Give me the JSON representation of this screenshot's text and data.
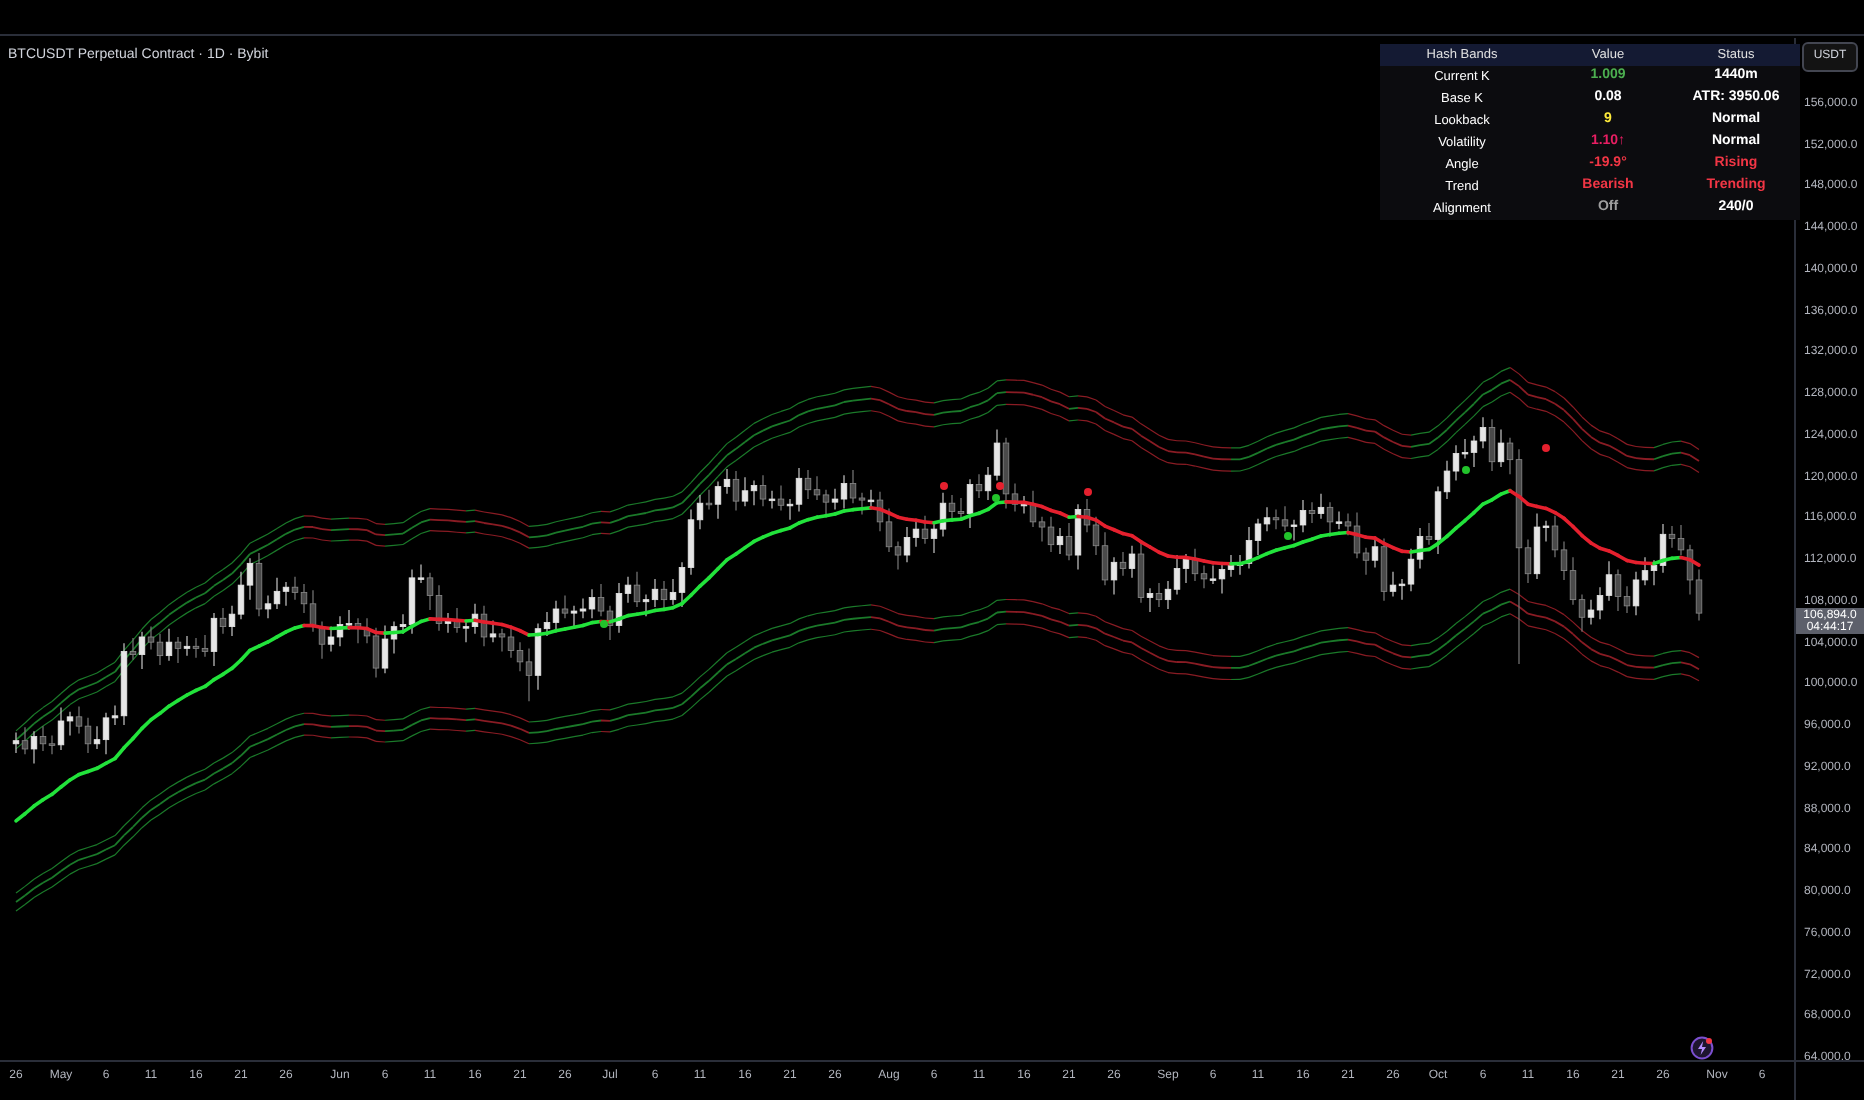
{
  "title": "BTCUSDT Perpetual Contract · 1D · Bybit",
  "currency_button": "USDT",
  "table": {
    "columns": [
      "Hash Bands",
      "Value",
      "Status"
    ],
    "rows": [
      {
        "label": "Current K",
        "value": {
          "text": "1.009",
          "color": "#4caf50"
        },
        "status": {
          "text": "1440m",
          "color": "#ffffff"
        }
      },
      {
        "label": "Base K",
        "value": {
          "text": "0.08",
          "color": "#ffffff"
        },
        "status": {
          "text": "ATR: 3950.06",
          "color": "#ffffff"
        }
      },
      {
        "label": "Lookback",
        "value": {
          "text": "9",
          "color": "#ffeb3b"
        },
        "status": {
          "text": "Normal",
          "color": "#ffffff"
        }
      },
      {
        "label": "Volatility",
        "value": {
          "text": "1.10↑",
          "color": "#e91e63"
        },
        "status": {
          "text": "Normal",
          "color": "#ffffff"
        }
      },
      {
        "label": "Angle",
        "value": {
          "text": "-19.9°",
          "color": "#f23645"
        },
        "status": {
          "text": "Rising",
          "color": "#f23645"
        }
      },
      {
        "label": "Trend",
        "value": {
          "text": "Bearish",
          "color": "#f23645"
        },
        "status": {
          "text": "Trending",
          "color": "#f23645"
        }
      },
      {
        "label": "Alignment",
        "value": {
          "text": "Off",
          "color": "#9e9e9e"
        },
        "status": {
          "text": "240/0",
          "color": "#ffffff"
        }
      }
    ]
  },
  "chart_data": {
    "type": "candlestick",
    "yticks": [
      {
        "value": 156000,
        "label": "156,000.0"
      },
      {
        "value": 152000,
        "label": "152,000.0"
      },
      {
        "value": 148000,
        "label": "148,000.0"
      },
      {
        "value": 144000,
        "label": "144,000.0"
      },
      {
        "value": 140000,
        "label": "140,000.0"
      },
      {
        "value": 136000,
        "label": "136,000.0"
      },
      {
        "value": 132000,
        "label": "132,000.0"
      },
      {
        "value": 128000,
        "label": "128,000.0"
      },
      {
        "value": 124000,
        "label": "124,000.0"
      },
      {
        "value": 120000,
        "label": "120,000.0"
      },
      {
        "value": 116000,
        "label": "116,000.0"
      },
      {
        "value": 112000,
        "label": "112,000.0"
      },
      {
        "value": 108000,
        "label": "108,000.0"
      },
      {
        "value": 104000,
        "label": "104,000.0"
      },
      {
        "value": 100000,
        "label": "100,000.0"
      },
      {
        "value": 96000,
        "label": "96,000.0"
      },
      {
        "value": 92000,
        "label": "92,000.0"
      },
      {
        "value": 88000,
        "label": "88,000.0"
      },
      {
        "value": 84000,
        "label": "84,000.0"
      },
      {
        "value": 80000,
        "label": "80,000.0"
      },
      {
        "value": 76000,
        "label": "76,000.0"
      },
      {
        "value": 72000,
        "label": "72,000.0"
      },
      {
        "value": 68000,
        "label": "68,000.0"
      },
      {
        "value": 64000,
        "label": "64,000.0"
      }
    ],
    "ylim": [
      59950,
      162360
    ],
    "categories": [
      "26",
      null,
      null,
      null,
      null,
      "May",
      null,
      null,
      null,
      null,
      "6",
      null,
      null,
      null,
      null,
      "11",
      null,
      null,
      null,
      null,
      "16",
      null,
      null,
      null,
      null,
      "21",
      null,
      null,
      null,
      null,
      "26",
      null,
      null,
      null,
      null,
      null,
      "Jun",
      null,
      null,
      null,
      null,
      "6",
      null,
      null,
      null,
      null,
      "11",
      null,
      null,
      null,
      null,
      "16",
      null,
      null,
      null,
      null,
      "21",
      null,
      null,
      null,
      null,
      "26",
      null,
      null,
      null,
      null,
      "Jul",
      null,
      null,
      null,
      null,
      "6",
      null,
      null,
      null,
      null,
      "11",
      null,
      null,
      null,
      null,
      "16",
      null,
      null,
      null,
      null,
      "21",
      null,
      null,
      null,
      null,
      "26",
      null,
      null,
      null,
      null,
      null,
      "Aug",
      null,
      null,
      null,
      null,
      "6",
      null,
      null,
      null,
      null,
      "11",
      null,
      null,
      null,
      null,
      "16",
      null,
      null,
      null,
      null,
      "21",
      null,
      null,
      null,
      null,
      "26",
      null,
      null,
      null,
      null,
      null,
      "Sep",
      null,
      null,
      null,
      null,
      "6",
      null,
      null,
      null,
      null,
      "11",
      null,
      null,
      null,
      null,
      "16",
      null,
      null,
      null,
      null,
      "21",
      null,
      null,
      null,
      null,
      "26",
      null,
      null,
      null,
      null,
      "Oct",
      null,
      null,
      null,
      null,
      "6",
      null,
      null,
      null,
      null,
      "11",
      null,
      null,
      null,
      null,
      "16",
      null,
      null,
      null,
      null,
      "21",
      null,
      null,
      null,
      null,
      "26",
      null,
      null,
      null,
      null,
      null,
      "Nov",
      null,
      null,
      null,
      null,
      "6"
    ],
    "ohlc": [
      [
        94300,
        95400,
        93400,
        94600
      ],
      [
        94600,
        95900,
        93300,
        93800
      ],
      [
        93800,
        95500,
        92400,
        95000
      ],
      [
        95000,
        96000,
        93600,
        94300
      ],
      [
        94300,
        95100,
        93300,
        94200
      ],
      [
        94200,
        97800,
        93700,
        96500
      ],
      [
        96500,
        97400,
        95100,
        96900
      ],
      [
        96900,
        97900,
        95300,
        96000
      ],
      [
        96000,
        96800,
        93400,
        94300
      ],
      [
        94300,
        96000,
        93800,
        94700
      ],
      [
        94700,
        97300,
        93300,
        96800
      ],
      [
        96800,
        98000,
        96100,
        97000
      ],
      [
        97000,
        104000,
        96100,
        103200
      ],
      [
        103200,
        104500,
        102400,
        102900
      ],
      [
        102900,
        105100,
        101500,
        104600
      ],
      [
        104600,
        105600,
        103400,
        104100
      ],
      [
        104100,
        104900,
        101900,
        102800
      ],
      [
        102800,
        105400,
        102300,
        104100
      ],
      [
        104100,
        104600,
        102100,
        103500
      ],
      [
        103500,
        104700,
        102800,
        103700
      ],
      [
        103700,
        104500,
        102600,
        103500
      ],
      [
        103500,
        104800,
        102700,
        103200
      ],
      [
        103200,
        106900,
        101800,
        106400
      ],
      [
        106400,
        107400,
        104900,
        105600
      ],
      [
        105600,
        107600,
        104700,
        106800
      ],
      [
        106800,
        110900,
        106300,
        109600
      ],
      [
        109600,
        112200,
        108200,
        111700
      ],
      [
        111700,
        112700,
        106600,
        107300
      ],
      [
        107300,
        108600,
        106400,
        107800
      ],
      [
        107800,
        110300,
        107300,
        109000
      ],
      [
        109000,
        109900,
        107600,
        109400
      ],
      [
        109400,
        110400,
        108200,
        108900
      ],
      [
        108900,
        109700,
        106900,
        107800
      ],
      [
        107800,
        109100,
        105100,
        105600
      ],
      [
        105600,
        106100,
        102500,
        103900
      ],
      [
        103900,
        105600,
        103200,
        104600
      ],
      [
        104600,
        106600,
        103700,
        105800
      ],
      [
        105800,
        107200,
        105300,
        105900
      ],
      [
        105900,
        106400,
        104000,
        105400
      ],
      [
        105400,
        106400,
        104000,
        104700
      ],
      [
        104700,
        105500,
        100700,
        101600
      ],
      [
        101600,
        105700,
        101100,
        104400
      ],
      [
        104400,
        106100,
        103000,
        105600
      ],
      [
        105600,
        106800,
        104900,
        105800
      ],
      [
        105800,
        111100,
        104900,
        110300
      ],
      [
        110300,
        111600,
        109800,
        110300
      ],
      [
        110300,
        110800,
        107200,
        108600
      ],
      [
        108600,
        109600,
        105200,
        105900
      ],
      [
        105900,
        106900,
        105000,
        106100
      ],
      [
        106100,
        107400,
        105000,
        105500
      ],
      [
        105500,
        106100,
        104100,
        105600
      ],
      [
        105600,
        107800,
        104900,
        106800
      ],
      [
        106800,
        107600,
        103700,
        104600
      ],
      [
        104600,
        106200,
        104100,
        104900
      ],
      [
        104900,
        105400,
        103200,
        104600
      ],
      [
        104600,
        105600,
        102600,
        103300
      ],
      [
        103300,
        104100,
        101300,
        102200
      ],
      [
        102200,
        103500,
        98400,
        100900
      ],
      [
        100900,
        105900,
        99500,
        105400
      ],
      [
        105400,
        107000,
        104700,
        106000
      ],
      [
        106000,
        108100,
        105100,
        107300
      ],
      [
        107300,
        108600,
        106400,
        106900
      ],
      [
        106900,
        107600,
        105500,
        107100
      ],
      [
        107100,
        108300,
        106400,
        107300
      ],
      [
        107300,
        109200,
        106400,
        108400
      ],
      [
        108400,
        109700,
        106600,
        107100
      ],
      [
        107100,
        107600,
        104300,
        105700
      ],
      [
        105700,
        109800,
        105000,
        108800
      ],
      [
        108800,
        110400,
        107900,
        109600
      ],
      [
        109600,
        110900,
        107500,
        108000
      ],
      [
        108000,
        108700,
        106600,
        108200
      ],
      [
        108200,
        110200,
        107500,
        109200
      ],
      [
        109200,
        110000,
        107300,
        108200
      ],
      [
        108200,
        110200,
        107700,
        108900
      ],
      [
        108900,
        111800,
        107500,
        111300
      ],
      [
        111300,
        116900,
        110600,
        115900
      ],
      [
        115900,
        118300,
        115000,
        117500
      ],
      [
        117500,
        118800,
        116900,
        117400
      ],
      [
        117400,
        119600,
        116000,
        119100
      ],
      [
        119100,
        120800,
        118400,
        119800
      ],
      [
        119800,
        120600,
        116800,
        117700
      ],
      [
        117700,
        120000,
        117200,
        118700
      ],
      [
        118700,
        119700,
        117300,
        119200
      ],
      [
        119200,
        120200,
        117200,
        117900
      ],
      [
        117900,
        118700,
        117000,
        117900
      ],
      [
        117900,
        119200,
        116800,
        117300
      ],
      [
        117300,
        117900,
        115900,
        117400
      ],
      [
        117400,
        120900,
        116700,
        119900
      ],
      [
        119900,
        120700,
        117900,
        118800
      ],
      [
        118800,
        120100,
        117800,
        118300
      ],
      [
        118300,
        118800,
        116200,
        117600
      ],
      [
        117600,
        118900,
        116900,
        117900
      ],
      [
        117900,
        120200,
        117000,
        119400
      ],
      [
        119400,
        120700,
        117500,
        118000
      ],
      [
        118000,
        118500,
        116400,
        117800
      ],
      [
        117800,
        118800,
        117100,
        117800
      ],
      [
        117800,
        118600,
        114800,
        115700
      ],
      [
        115700,
        117000,
        112800,
        113300
      ],
      [
        113300,
        113800,
        111100,
        112500
      ],
      [
        112500,
        115200,
        111800,
        114200
      ],
      [
        114200,
        115800,
        113300,
        115000
      ],
      [
        115000,
        116300,
        113600,
        114100
      ],
      [
        114100,
        115500,
        112700,
        115000
      ],
      [
        115000,
        118500,
        114300,
        117500
      ],
      [
        117500,
        118300,
        115800,
        116700
      ],
      [
        116700,
        118000,
        116000,
        116500
      ],
      [
        116500,
        119800,
        115100,
        119300
      ],
      [
        119300,
        120300,
        118000,
        118700
      ],
      [
        118700,
        121000,
        117800,
        120200
      ],
      [
        120200,
        124600,
        119700,
        123300
      ],
      [
        123300,
        123800,
        117000,
        118400
      ],
      [
        118400,
        119400,
        116700,
        117400
      ],
      [
        117400,
        118200,
        116500,
        117400
      ],
      [
        117400,
        118700,
        115200,
        115700
      ],
      [
        115700,
        116200,
        113800,
        115200
      ],
      [
        115200,
        116200,
        112800,
        113500
      ],
      [
        113500,
        115100,
        112600,
        114300
      ],
      [
        114300,
        115600,
        112000,
        112500
      ],
      [
        112500,
        117400,
        111100,
        116900
      ],
      [
        116900,
        117900,
        114700,
        115400
      ],
      [
        115400,
        116200,
        112500,
        113400
      ],
      [
        113400,
        114700,
        109600,
        110100
      ],
      [
        110100,
        112300,
        108700,
        111800
      ],
      [
        111800,
        112800,
        110500,
        111200
      ],
      [
        111200,
        113400,
        110300,
        112600
      ],
      [
        112600,
        113900,
        107900,
        108400
      ],
      [
        108400,
        109300,
        107000,
        108800
      ],
      [
        108800,
        109800,
        107500,
        108200
      ],
      [
        108200,
        110000,
        107300,
        109200
      ],
      [
        109200,
        112500,
        108700,
        111200
      ],
      [
        111200,
        112600,
        109800,
        112100
      ],
      [
        112100,
        113100,
        110000,
        110700
      ],
      [
        110700,
        111500,
        109300,
        110200
      ],
      [
        110200,
        111500,
        109700,
        110200
      ],
      [
        110200,
        111600,
        108800,
        111100
      ],
      [
        111100,
        112500,
        110400,
        111500
      ],
      [
        111500,
        112500,
        110600,
        111700
      ],
      [
        111700,
        115200,
        111200,
        113900
      ],
      [
        113900,
        116000,
        112500,
        115500
      ],
      [
        115500,
        117100,
        114800,
        116100
      ],
      [
        116100,
        116900,
        115000,
        115900
      ],
      [
        115900,
        117200,
        114800,
        115300
      ],
      [
        115300,
        115900,
        113900,
        115400
      ],
      [
        115400,
        117800,
        114700,
        116800
      ],
      [
        116800,
        117600,
        115600,
        116500
      ],
      [
        116500,
        118400,
        116000,
        117100
      ],
      [
        117100,
        117600,
        114300,
        115700
      ],
      [
        115700,
        116700,
        115000,
        115700
      ],
      [
        115700,
        116500,
        114400,
        115300
      ],
      [
        115300,
        116600,
        112200,
        112700
      ],
      [
        112700,
        113200,
        110600,
        112000
      ],
      [
        112000,
        114300,
        111300,
        113300
      ],
      [
        113300,
        114100,
        108100,
        109000
      ],
      [
        109000,
        110900,
        108500,
        109600
      ],
      [
        109600,
        110200,
        108200,
        109700
      ],
      [
        109700,
        113100,
        109000,
        112100
      ],
      [
        112100,
        115100,
        111200,
        114300
      ],
      [
        114300,
        115600,
        113500,
        114000
      ],
      [
        114000,
        119100,
        112600,
        118600
      ],
      [
        118600,
        121600,
        117900,
        120600
      ],
      [
        120600,
        123100,
        119700,
        122300
      ],
      [
        122300,
        123700,
        121800,
        122400
      ],
      [
        122400,
        124000,
        121000,
        123500
      ],
      [
        123500,
        125800,
        122800,
        124800
      ],
      [
        124800,
        125600,
        120600,
        121500
      ],
      [
        121500,
        124600,
        121000,
        123300
      ],
      [
        123300,
        123800,
        120300,
        121700
      ],
      [
        121700,
        122700,
        102000,
        113200
      ],
      [
        113200,
        114000,
        109800,
        110700
      ],
      [
        110700,
        116500,
        110200,
        115200
      ],
      [
        115200,
        115800,
        113800,
        115300
      ],
      [
        115300,
        116300,
        112300,
        113000
      ],
      [
        113000,
        113800,
        110100,
        111000
      ],
      [
        111000,
        112300,
        107700,
        108200
      ],
      [
        108200,
        108700,
        105100,
        106500
      ],
      [
        106500,
        108200,
        105800,
        107200
      ],
      [
        107200,
        109400,
        106300,
        108600
      ],
      [
        108600,
        111900,
        108100,
        110600
      ],
      [
        110600,
        111100,
        107100,
        108500
      ],
      [
        108500,
        109500,
        106900,
        107600
      ],
      [
        107600,
        110900,
        106700,
        110100
      ],
      [
        110100,
        112300,
        109600,
        111000
      ],
      [
        111000,
        112000,
        109600,
        111500
      ],
      [
        111500,
        115500,
        110800,
        114500
      ],
      [
        114500,
        115300,
        113200,
        114100
      ],
      [
        114100,
        115400,
        112500,
        113000
      ],
      [
        113000,
        113500,
        108700,
        110100
      ],
      [
        110100,
        111100,
        106200,
        106900
      ],
      null,
      null,
      null,
      null,
      null,
      null,
      null
    ]
  },
  "last_price": "106,894.0",
  "countdown": "04:44:17"
}
